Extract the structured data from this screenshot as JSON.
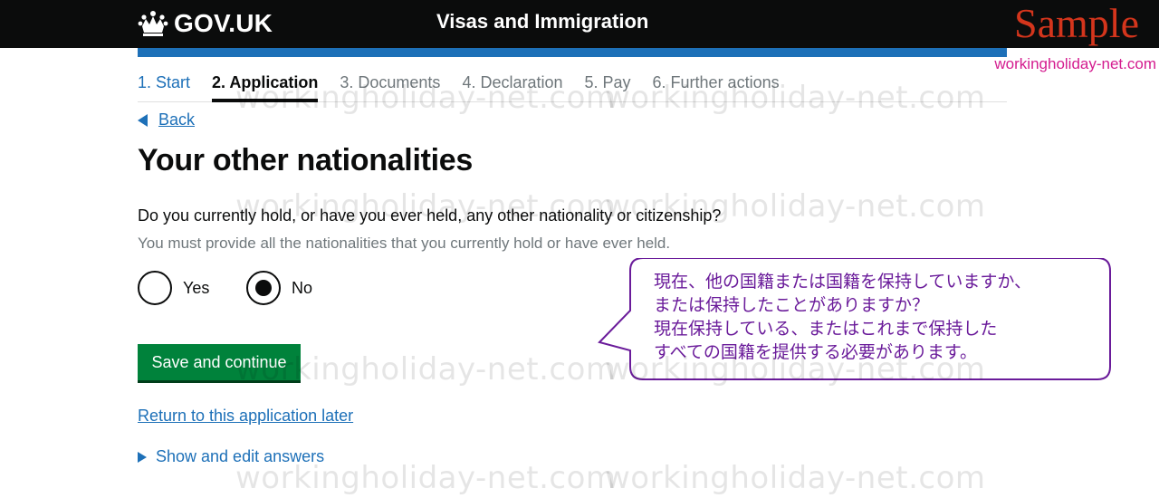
{
  "header": {
    "logo_text": "GOV.UK",
    "service_name": "Visas and Immigration"
  },
  "watermark": {
    "sample_label": "Sample",
    "site_url": "workingholiday-net.com",
    "overlay_text": "workingholiday-net.com"
  },
  "steps": [
    {
      "label": "1. Start",
      "state": "done"
    },
    {
      "label": "2. Application",
      "state": "active"
    },
    {
      "label": "3. Documents",
      "state": "upcoming"
    },
    {
      "label": "4. Declaration",
      "state": "upcoming"
    },
    {
      "label": "5. Pay",
      "state": "upcoming"
    },
    {
      "label": "6. Further actions",
      "state": "upcoming"
    }
  ],
  "back_link": "Back",
  "page_title": "Your other nationalities",
  "question": "Do you currently hold, or have you ever held, any other nationality or citizenship?",
  "hint": "You must provide all the nationalities that you currently hold or have ever held.",
  "radios": {
    "yes_label": "Yes",
    "no_label": "No",
    "selected": "No"
  },
  "save_button": "Save and continue",
  "return_link": "Return to this application later",
  "details_summary": "Show and edit answers",
  "callout_text": "現在、他の国籍または国籍を保持していますか、\nまたは保持したことがありますか？\n現在保持している、またはこれまで保持した\nすべての国籍を提供する必要があります。",
  "colors": {
    "header_bg": "#0b0c0c",
    "brand_blue": "#1d70b8",
    "button_green": "#00823b",
    "callout_purple": "#6a1b9a",
    "sample_red": "#d4351c"
  }
}
